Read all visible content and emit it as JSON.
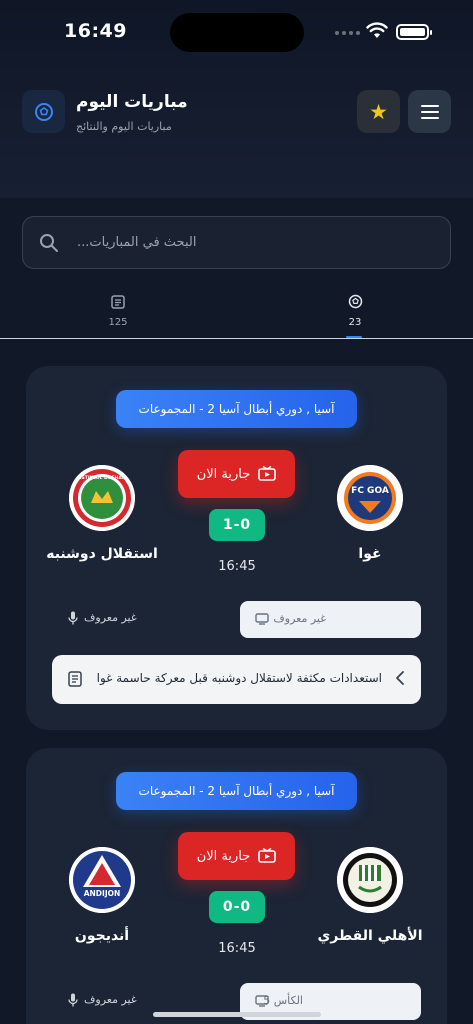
{
  "status_bar": {
    "time": "16:49"
  },
  "header": {
    "title": "مباريات اليوم",
    "subtitle": "مباريات اليوم والنتائج",
    "logo_icon": "soccer-ball-icon",
    "favorites_icon": "star-icon",
    "menu_icon": "hamburger-icon"
  },
  "search": {
    "placeholder": "...البحث في المباريات"
  },
  "tabs": [
    {
      "icon": "newspaper-icon",
      "count": "125",
      "active": false
    },
    {
      "icon": "soccer-ball-icon",
      "count": "23",
      "active": true
    }
  ],
  "colors": {
    "accent": "#3b82f6",
    "live": "#dc2626",
    "score": "#10b981",
    "favorite": "#f5c518"
  },
  "matches": [
    {
      "league": "آسيا , دوري أبطال آسيا 2 - المجموعات",
      "live_label": "جارية الان",
      "score": "1-0",
      "time": "16:45",
      "home_team": "غوا",
      "away_team": "استقلال دوشنبه",
      "home_logo_text": "FC GOA",
      "away_logo_text": "FC ISTIKLOL DUSHANBE",
      "channel": "غير معروف",
      "commentator": "غير معروف",
      "news": "استعدادات مكثفة لاستقلال دوشنبه قبل معركة حاسمة غوا"
    },
    {
      "league": "آسيا , دوري أبطال آسيا 2 - المجموعات",
      "live_label": "جارية الان",
      "score": "0-0",
      "time": "16:45",
      "home_team": "الأهلي القطري",
      "away_team": "أنديجون",
      "home_logo_text": "",
      "away_logo_text": "ANDIJON",
      "channel": "الكأس 5",
      "commentator": "غير معروف"
    }
  ]
}
